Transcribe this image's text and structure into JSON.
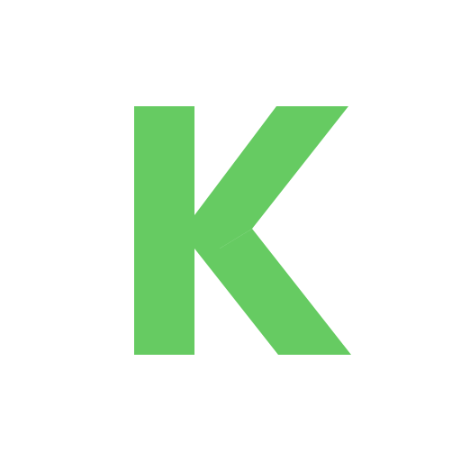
{
  "logo": {
    "lettering": "K",
    "color": "#66cb62",
    "background": "#ffffff"
  }
}
